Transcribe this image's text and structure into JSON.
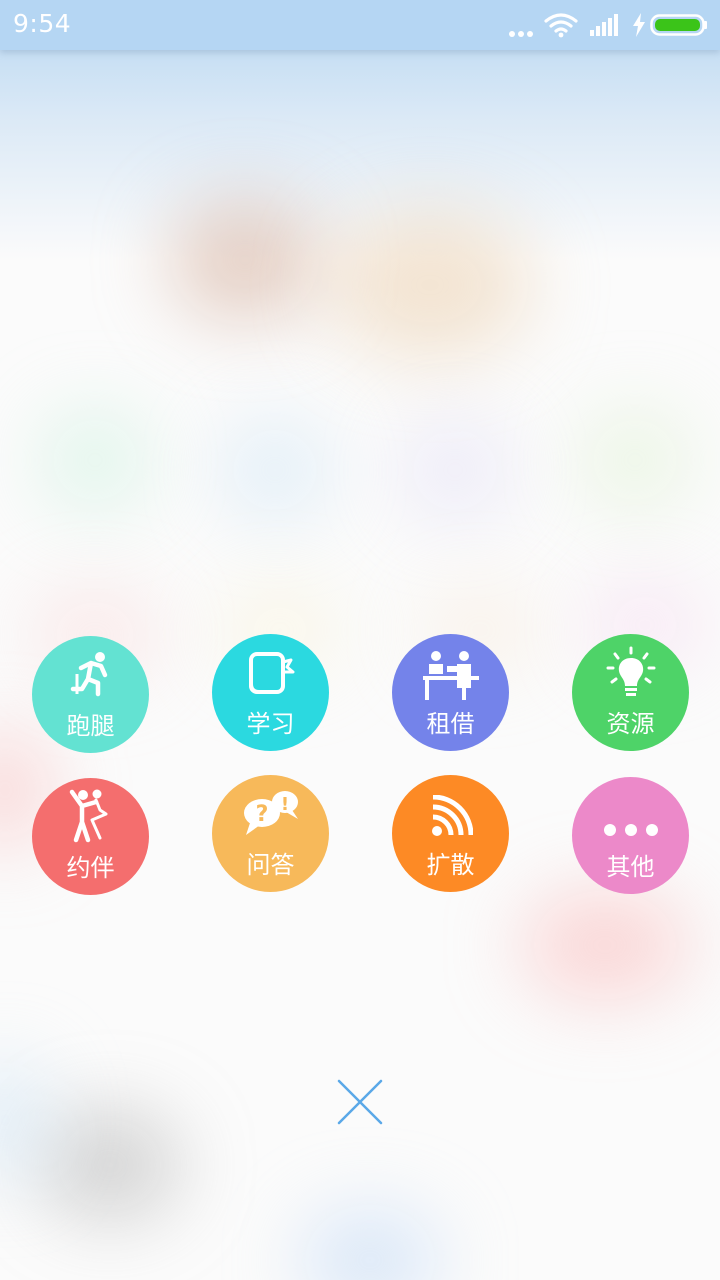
{
  "status_bar": {
    "time": "9:54",
    "icons": [
      "more-dots-icon",
      "wifi-icon",
      "signal-icon",
      "charging-bolt-icon",
      "battery-icon"
    ],
    "battery_color": "#3bc419"
  },
  "menu": {
    "items": [
      {
        "label": "跑腿",
        "icon": "running-man-icon",
        "color": "#63e2d2"
      },
      {
        "label": "学习",
        "icon": "book-icon",
        "color": "#2bd9e0"
      },
      {
        "label": "租借",
        "icon": "rental-desk-icon",
        "color": "#7483ea"
      },
      {
        "label": "资源",
        "icon": "lightbulb-icon",
        "color": "#4ed368"
      },
      {
        "label": "约伴",
        "icon": "dancing-couple-icon",
        "color": "#f46e6e"
      },
      {
        "label": "问答",
        "icon": "speech-bubbles-icon",
        "color": "#f7b95a"
      },
      {
        "label": "扩散",
        "icon": "broadcast-icon",
        "color": "#fd8a25"
      },
      {
        "label": "其他",
        "icon": "more-dots-icon",
        "color": "#ec89c9"
      }
    ]
  },
  "close": {
    "icon": "close-icon",
    "color": "#5aa8e8"
  }
}
